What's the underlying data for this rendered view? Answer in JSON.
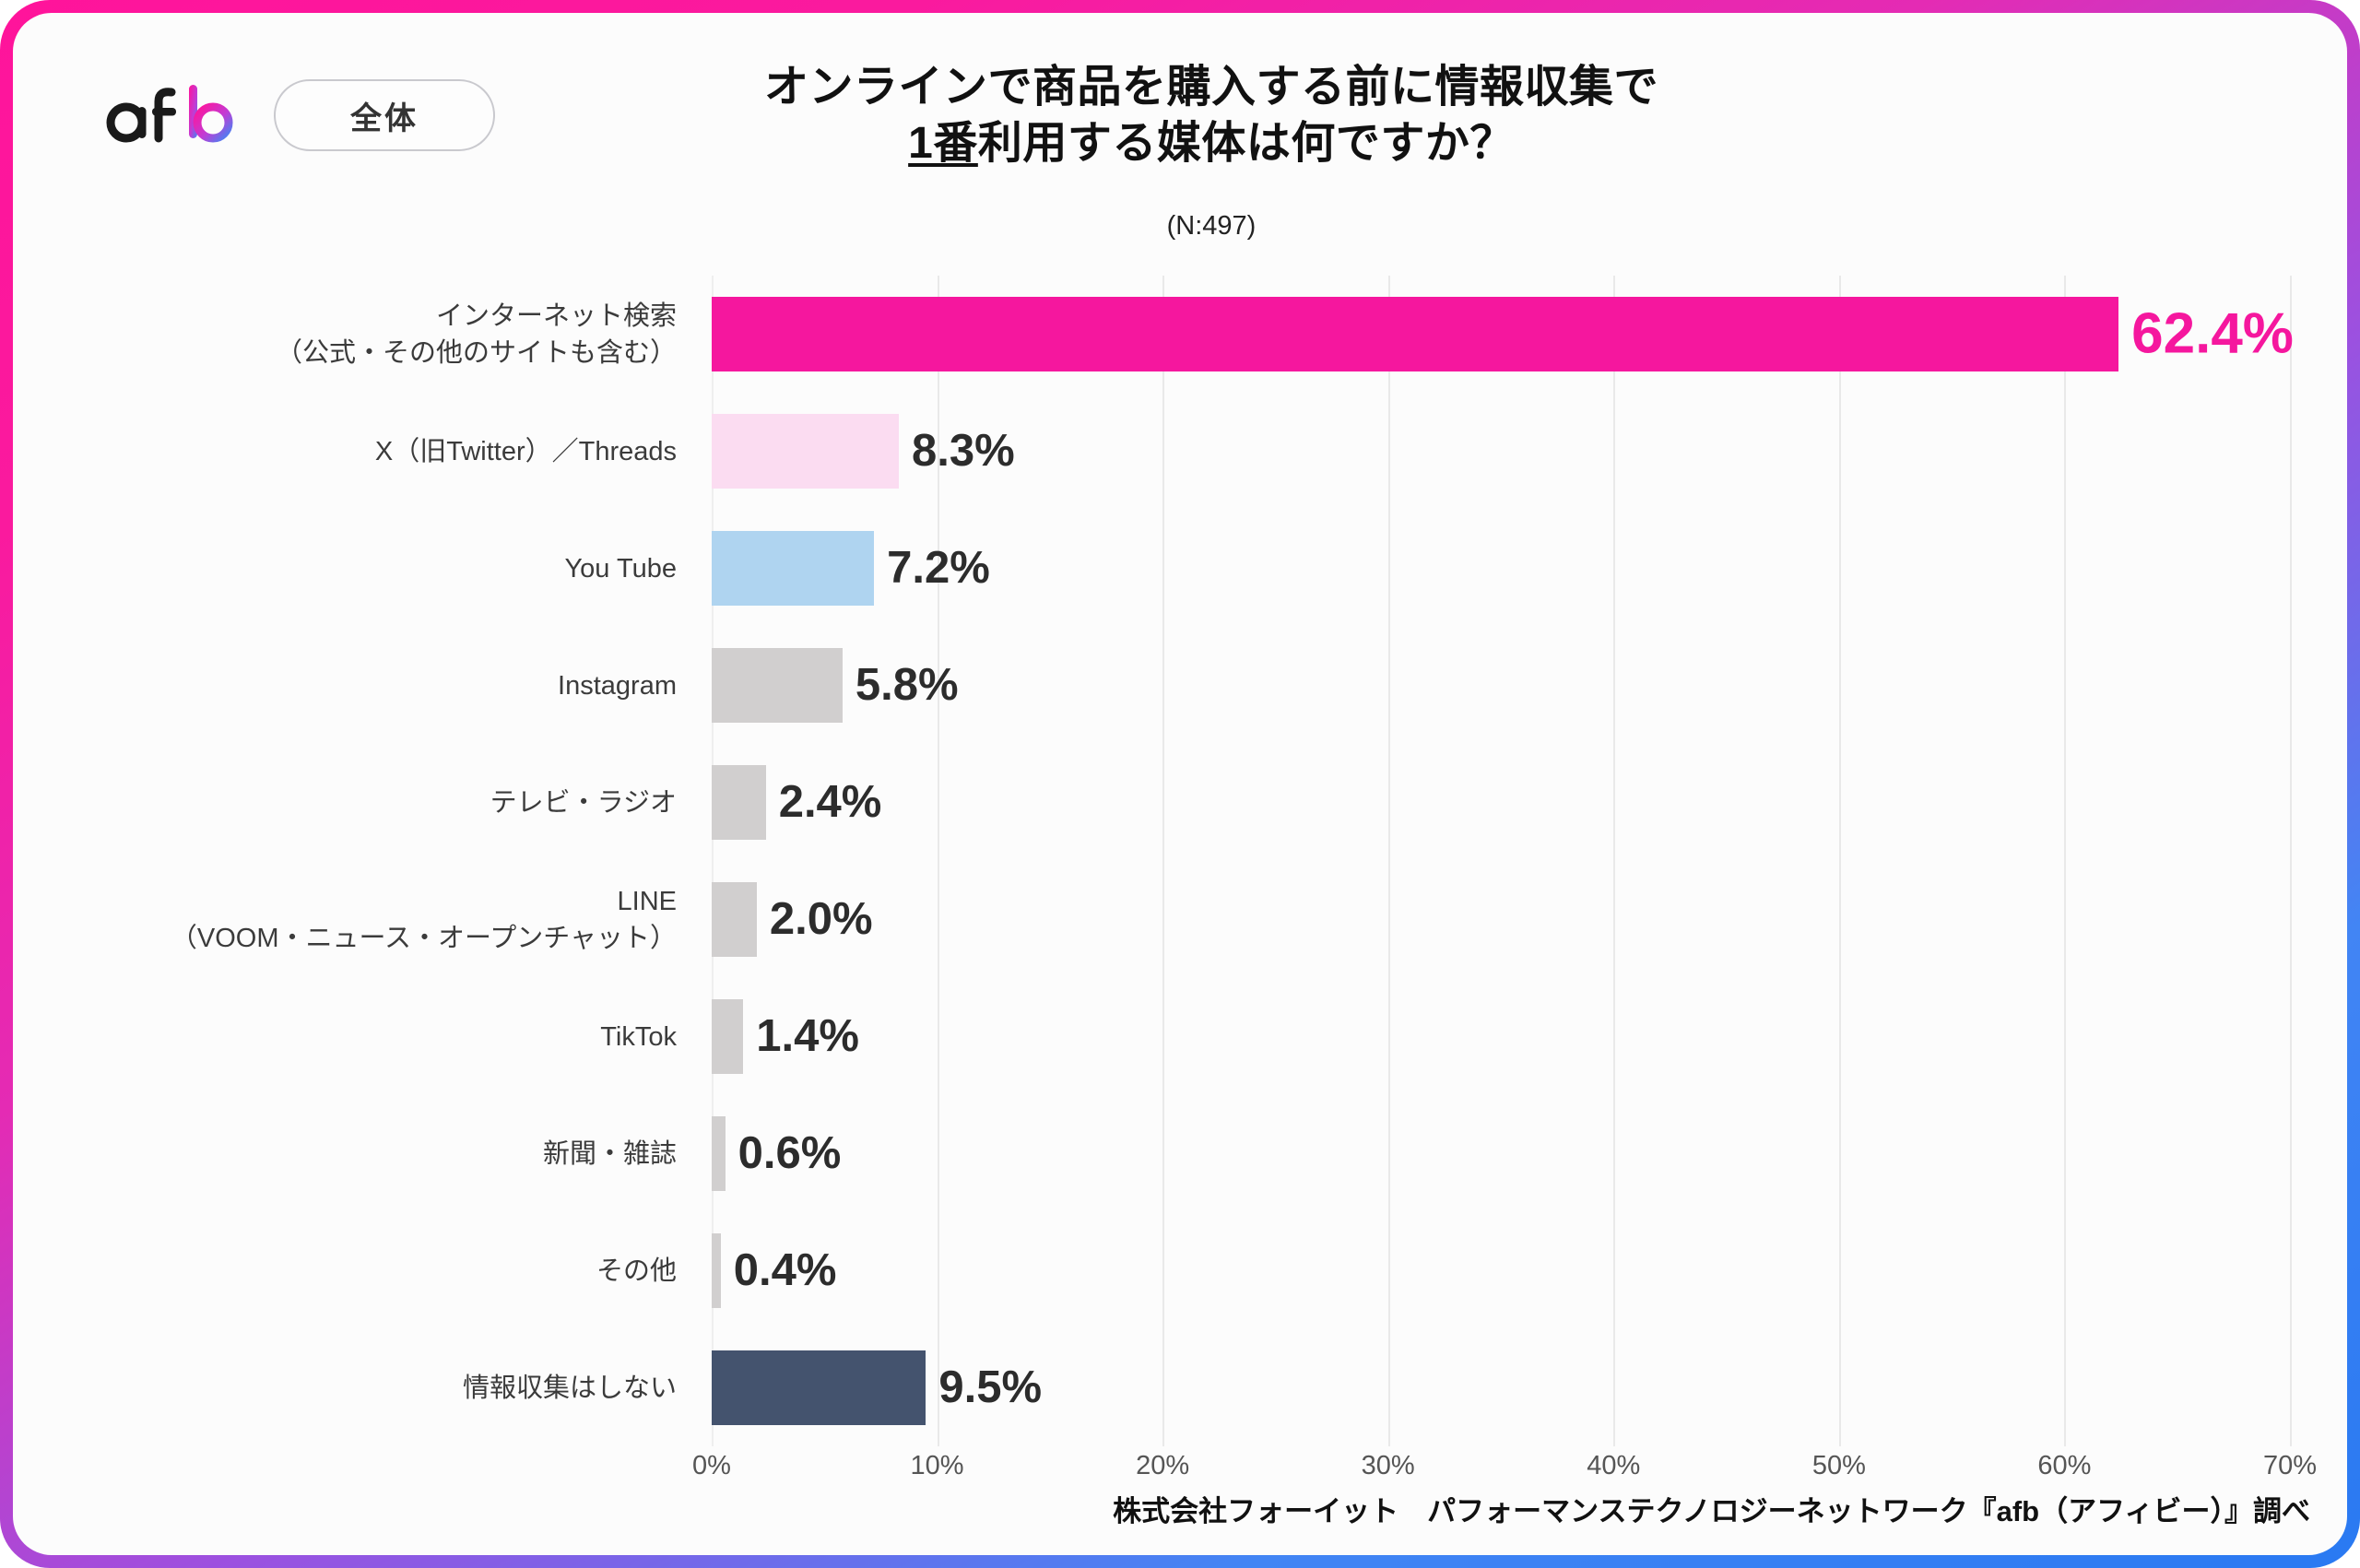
{
  "brand": {
    "logo_text": "afb",
    "badge_label": "全体"
  },
  "header": {
    "title_line1": "オンラインで商品を購入する前に情報収集で",
    "title_line2_underlined": "1番",
    "title_line2_rest": "利用する媒体は何ですか？",
    "subtitle": "(N:497)"
  },
  "footer": {
    "source": "株式会社フォーイット　パフォーマンステクノロジーネットワーク『afb（アフィビー）』調べ"
  },
  "colors": {
    "accent_pink": "#F5179E",
    "light_pink": "#FBDCF1",
    "light_blue": "#AFD4F0",
    "gray": "#D1CFCF",
    "dark_slate": "#44536E",
    "frame_start": "#FF149B",
    "frame_end": "#2979F2",
    "value_text": "#2C2C2C",
    "gridline": "#E9E9E9"
  },
  "chart_data": {
    "type": "bar",
    "orientation": "horizontal",
    "title": "オンラインで商品を購入する前に情報収集で1番利用する媒体は何ですか？",
    "subtitle": "(N:497)",
    "xlabel": "",
    "ylabel": "",
    "xlim": [
      0,
      70
    ],
    "xticks": [
      "0%",
      "10%",
      "20%",
      "30%",
      "40%",
      "50%",
      "60%",
      "70%"
    ],
    "xtick_values": [
      0,
      10,
      20,
      30,
      40,
      50,
      60,
      70
    ],
    "grid": true,
    "legend": false,
    "sample_size": 497,
    "categories": [
      "インターネット検索\n（公式・その他のサイトも含む）",
      "X（旧Twitter）／Threads",
      "You Tube",
      "Instagram",
      "テレビ・ラジオ",
      "LINE\n（VOOM・ニュース・オープンチャット）",
      "TikTok",
      "新聞・雑誌",
      "その他",
      "情報収集はしない"
    ],
    "values": [
      62.4,
      8.3,
      7.2,
      5.8,
      2.4,
      2.0,
      1.4,
      0.6,
      0.4,
      9.5
    ],
    "value_labels": [
      "62.4%",
      "8.3%",
      "7.2%",
      "5.8%",
      "2.4%",
      "2.0%",
      "1.4%",
      "0.6%",
      "0.4%",
      "9.5%"
    ],
    "bar_colors": [
      "#F5179E",
      "#FBDCF1",
      "#AFD4F0",
      "#D1CFCF",
      "#D1CFCF",
      "#D1CFCF",
      "#D1CFCF",
      "#D1CFCF",
      "#D1CFCF",
      "#44536E"
    ],
    "bars": [
      {
        "label_lines": [
          "インターネット検索",
          "（公式・その他のサイトも含む）"
        ],
        "value": 62.4,
        "value_label": "62.4%",
        "color": "#F5179E",
        "emphasis": true
      },
      {
        "label_lines": [
          "X（旧Twitter）／Threads"
        ],
        "value": 8.3,
        "value_label": "8.3%",
        "color": "#FBDCF1",
        "emphasis": false
      },
      {
        "label_lines": [
          "You Tube"
        ],
        "value": 7.2,
        "value_label": "7.2%",
        "color": "#AFD4F0",
        "emphasis": false
      },
      {
        "label_lines": [
          "Instagram"
        ],
        "value": 5.8,
        "value_label": "5.8%",
        "color": "#D1CFCF",
        "emphasis": false
      },
      {
        "label_lines": [
          "テレビ・ラジオ"
        ],
        "value": 2.4,
        "value_label": "2.4%",
        "color": "#D1CFCF",
        "emphasis": false
      },
      {
        "label_lines": [
          "LINE",
          "（VOOM・ニュース・オープンチャット）"
        ],
        "value": 2.0,
        "value_label": "2.0%",
        "color": "#D1CFCF",
        "emphasis": false
      },
      {
        "label_lines": [
          "TikTok"
        ],
        "value": 1.4,
        "value_label": "1.4%",
        "color": "#D1CFCF",
        "emphasis": false
      },
      {
        "label_lines": [
          "新聞・雑誌"
        ],
        "value": 0.6,
        "value_label": "0.6%",
        "color": "#D1CFCF",
        "emphasis": false
      },
      {
        "label_lines": [
          "その他"
        ],
        "value": 0.4,
        "value_label": "0.4%",
        "color": "#D1CFCF",
        "emphasis": false
      },
      {
        "label_lines": [
          "情報収集はしない"
        ],
        "value": 9.5,
        "value_label": "9.5%",
        "color": "#44536E",
        "emphasis": false
      }
    ]
  }
}
